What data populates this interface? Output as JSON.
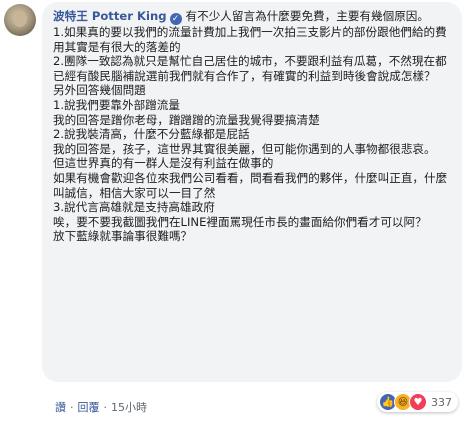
{
  "comment": {
    "author": "波特王 Potter King",
    "lines": [
      "有不少人留言為什麼要免費，主要有幾個原因。",
      "1.如果真的要以我們的流量計費加上我們一次拍三支影片的部份跟他們給的費用其實是有很大的落差的",
      "2.團隊一致認為就只是幫忙自己居住的城市，不要跟利益有瓜葛，不然現在都已經有酸民腦補說選前我們就有合作了，有確實的利益到時後會說成怎樣？",
      "另外回答幾個問題",
      "1.說我們要靠外部蹭流量",
      "我的回答是蹭你老母，蹭蹭蹭的流量我覺得要搞清楚",
      "2.說我裝清高，什麼不分藍綠都是屁話",
      "我的回答是，孩子，這世界其實很美麗，但可能你遇到的人事物都很悲哀。",
      "但這世界真的有一群人是沒有利益在做事的",
      "如果有機會歡迎各位來我們公司看看，問看看我們的夥伴，什麼叫正直，什麼叫誠信，相信大家可以一目了然",
      "3.說代言高雄就是支持高雄政府",
      "唉，要不要我截圖我們在LINE裡面罵現任市長的畫面給你們看才可以阿？",
      "放下藍綠就事論事很難嗎？"
    ]
  },
  "actions": {
    "like": "讚",
    "reply": "回覆",
    "time": "15小時"
  },
  "reactions": {
    "icons": [
      "like-icon",
      "haha-icon",
      "love-icon"
    ],
    "count": "337"
  },
  "colors": {
    "bubble": "#f2f3f5",
    "author": "#385898",
    "verified": "#4267b2"
  }
}
